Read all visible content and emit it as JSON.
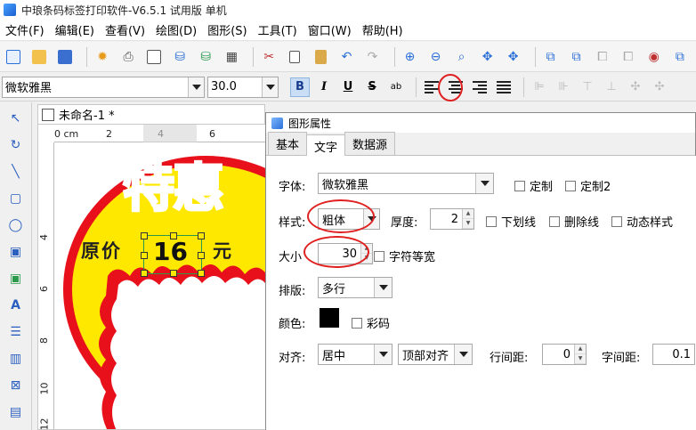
{
  "window": {
    "title": "中琅条码标签打印软件-V6.5.1 试用版 单机"
  },
  "menu": [
    "文件(F)",
    "编辑(E)",
    "查看(V)",
    "绘图(D)",
    "图形(S)",
    "工具(T)",
    "窗口(W)",
    "帮助(H)"
  ],
  "format_bar": {
    "font": "微软雅黑",
    "size": "30.0",
    "bold": "B",
    "italic": "I",
    "underline": "U",
    "strike": "S",
    "case": "ab"
  },
  "document": {
    "tab": "未命名-1 *"
  },
  "ruler": {
    "h": [
      "0 cm",
      "2",
      "4",
      "6"
    ],
    "v": [
      "4",
      "6",
      "8",
      "10",
      "12"
    ]
  },
  "label_preview": {
    "big_text": "特惠",
    "price_label": "原价",
    "price_value": "16",
    "unit": "元"
  },
  "dialog": {
    "title": "图形属性",
    "tabs": [
      "基本",
      "文字",
      "数据源"
    ],
    "active_tab": "文字",
    "font_label": "字体:",
    "font_value": "微软雅黑",
    "custom": "定制",
    "custom2": "定制2",
    "style_label": "样式:",
    "style_value": "粗体",
    "thickness_label": "厚度:",
    "thickness_value": "2",
    "underline": "下划线",
    "strikethrough": "删除线",
    "dynamic_style": "动态样式",
    "size_label": "大小",
    "size_value": "30",
    "monospace": "字符等宽",
    "layout_label": "排版:",
    "layout_value": "多行",
    "color_label": "颜色:",
    "color_swatch": "#000000",
    "colorful": "彩码",
    "align_label": "对齐:",
    "align_h": "居中",
    "align_v": "顶部对齐",
    "line_spacing_label": "行间距:",
    "line_spacing_value": "0",
    "char_spacing_label": "字间距:",
    "char_spacing_value": "0.1"
  },
  "colors": {
    "highlight": "#e02020",
    "label_yellow": "#ffe800",
    "label_red": "#e8101a"
  }
}
